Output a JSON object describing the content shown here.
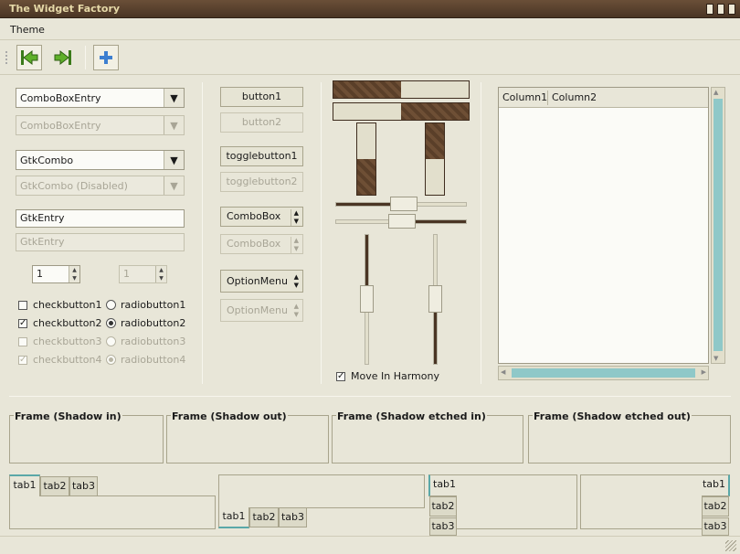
{
  "window": {
    "title": "The Widget Factory"
  },
  "menu": {
    "theme": "Theme"
  },
  "combos": {
    "entry": "ComboBoxEntry",
    "entry_disabled": "ComboBoxEntry",
    "gtk": "GtkCombo",
    "gtk_disabled": "GtkCombo (Disabled)"
  },
  "entries": {
    "normal": "GtkEntry",
    "disabled": "GtkEntry"
  },
  "spins": {
    "normal": "1",
    "disabled": "1"
  },
  "checks": [
    "checkbutton1",
    "checkbutton2",
    "checkbutton3",
    "checkbutton4"
  ],
  "radios": [
    "radiobutton1",
    "radiobutton2",
    "radiobutton3",
    "radiobutton4"
  ],
  "buttons": {
    "b1": "button1",
    "b2": "button2",
    "t1": "togglebutton1",
    "t2": "togglebutton2",
    "cb1": "ComboBox",
    "cb2": "ComboBox",
    "om1": "OptionMenu",
    "om2": "OptionMenu"
  },
  "progress": {
    "h1": 0.5,
    "h2": 0.5,
    "v1": 0.5,
    "v2": 0.5
  },
  "move_harmony": "Move In Harmony",
  "tree": {
    "col1": "Column1",
    "col2": "Column2"
  },
  "frames": [
    "Frame (Shadow in)",
    "Frame (Shadow out)",
    "Frame (Shadow etched in)",
    "Frame (Shadow etched out)"
  ],
  "tabs": [
    "tab1",
    "tab2",
    "tab3"
  ],
  "icons": {
    "back": "go-first-icon",
    "forward": "go-last-icon",
    "add": "add-icon"
  }
}
